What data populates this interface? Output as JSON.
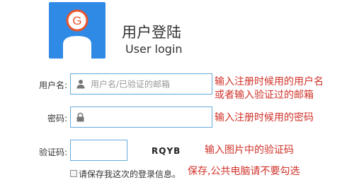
{
  "header": {
    "title": "用户登陆",
    "subtitle": "User login",
    "logo_letter": "G",
    "logo_icon": "user-avatar-icon"
  },
  "form": {
    "username": {
      "label": "用户名:",
      "placeholder": "用户名/已验证的邮箱",
      "icon": "user-icon",
      "hint_line1": "输入注册时候用的用户名",
      "hint_line2": "或者输入验证过的邮箱"
    },
    "password": {
      "label": "密码:",
      "icon": "lock-icon",
      "hint": "输入注册时候用的密码"
    },
    "captcha": {
      "label": "验证码:",
      "image_text": "RQYB",
      "hint": "输入图片中的验证码"
    },
    "remember": {
      "label": "请保存我这次的登录信息。",
      "checked": false,
      "hint": "保存,公共电脑请不要勾选"
    }
  },
  "colors": {
    "logo_bg": "#2f8ae5",
    "logo_ring": "#e8542c",
    "field_border": "#66aadd",
    "hint_text": "#d0332a"
  }
}
